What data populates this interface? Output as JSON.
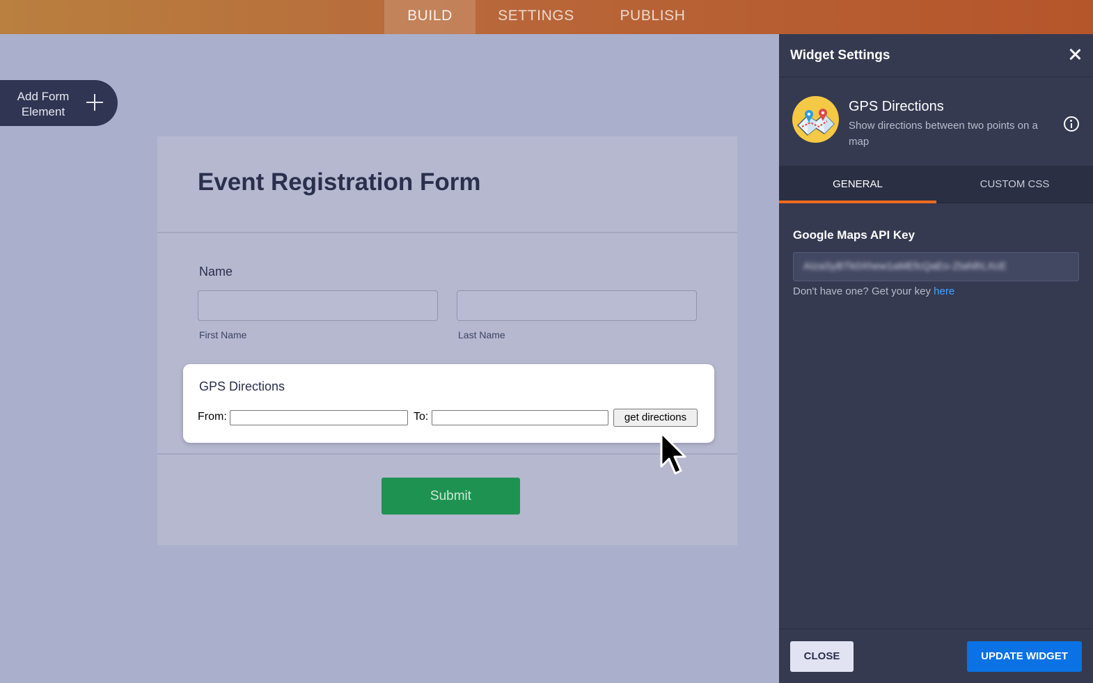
{
  "topbar": {
    "tabs": [
      {
        "label": "BUILD",
        "active": true
      },
      {
        "label": "SETTINGS",
        "active": false
      },
      {
        "label": "PUBLISH",
        "active": false
      }
    ],
    "gradient_colors": [
      "#b9803f",
      "#b5552a"
    ]
  },
  "canvas": {
    "add_element": {
      "label": "Add Form Element",
      "icon": "plus-icon"
    }
  },
  "form": {
    "title": "Event Registration Form",
    "name_label": "Name",
    "first_name_sublabel": "First Name",
    "last_name_sublabel": "Last Name",
    "first_name_value": "",
    "last_name_value": "",
    "gps": {
      "title": "GPS Directions",
      "from_label": "From:",
      "to_label": "To:",
      "from_value": "",
      "to_value": "",
      "button_label": "get directions"
    },
    "submit_label": "Submit",
    "submit_color": "#1e9351"
  },
  "panel": {
    "title": "Widget Settings",
    "close_icon": "close-icon",
    "widget": {
      "name": "GPS Directions",
      "description": "Show directions between two points on a map",
      "icon": "map-icon",
      "icon_bg": "#f5c944"
    },
    "tabs": [
      {
        "label": "GENERAL",
        "active": true
      },
      {
        "label": "CUSTOM CSS",
        "active": false
      }
    ],
    "active_tab_color": "#f06a1f",
    "api_key": {
      "label": "Google Maps API Key",
      "value": "AIzaSyBTk0Xhew1aMEfcQaEo-ZtaNfrLXcE",
      "help_text": "Don't have one? Get your key ",
      "help_link": "here"
    },
    "footer": {
      "close_label": "CLOSE",
      "update_label": "UPDATE WIDGET",
      "update_color": "#0a72e5"
    }
  }
}
